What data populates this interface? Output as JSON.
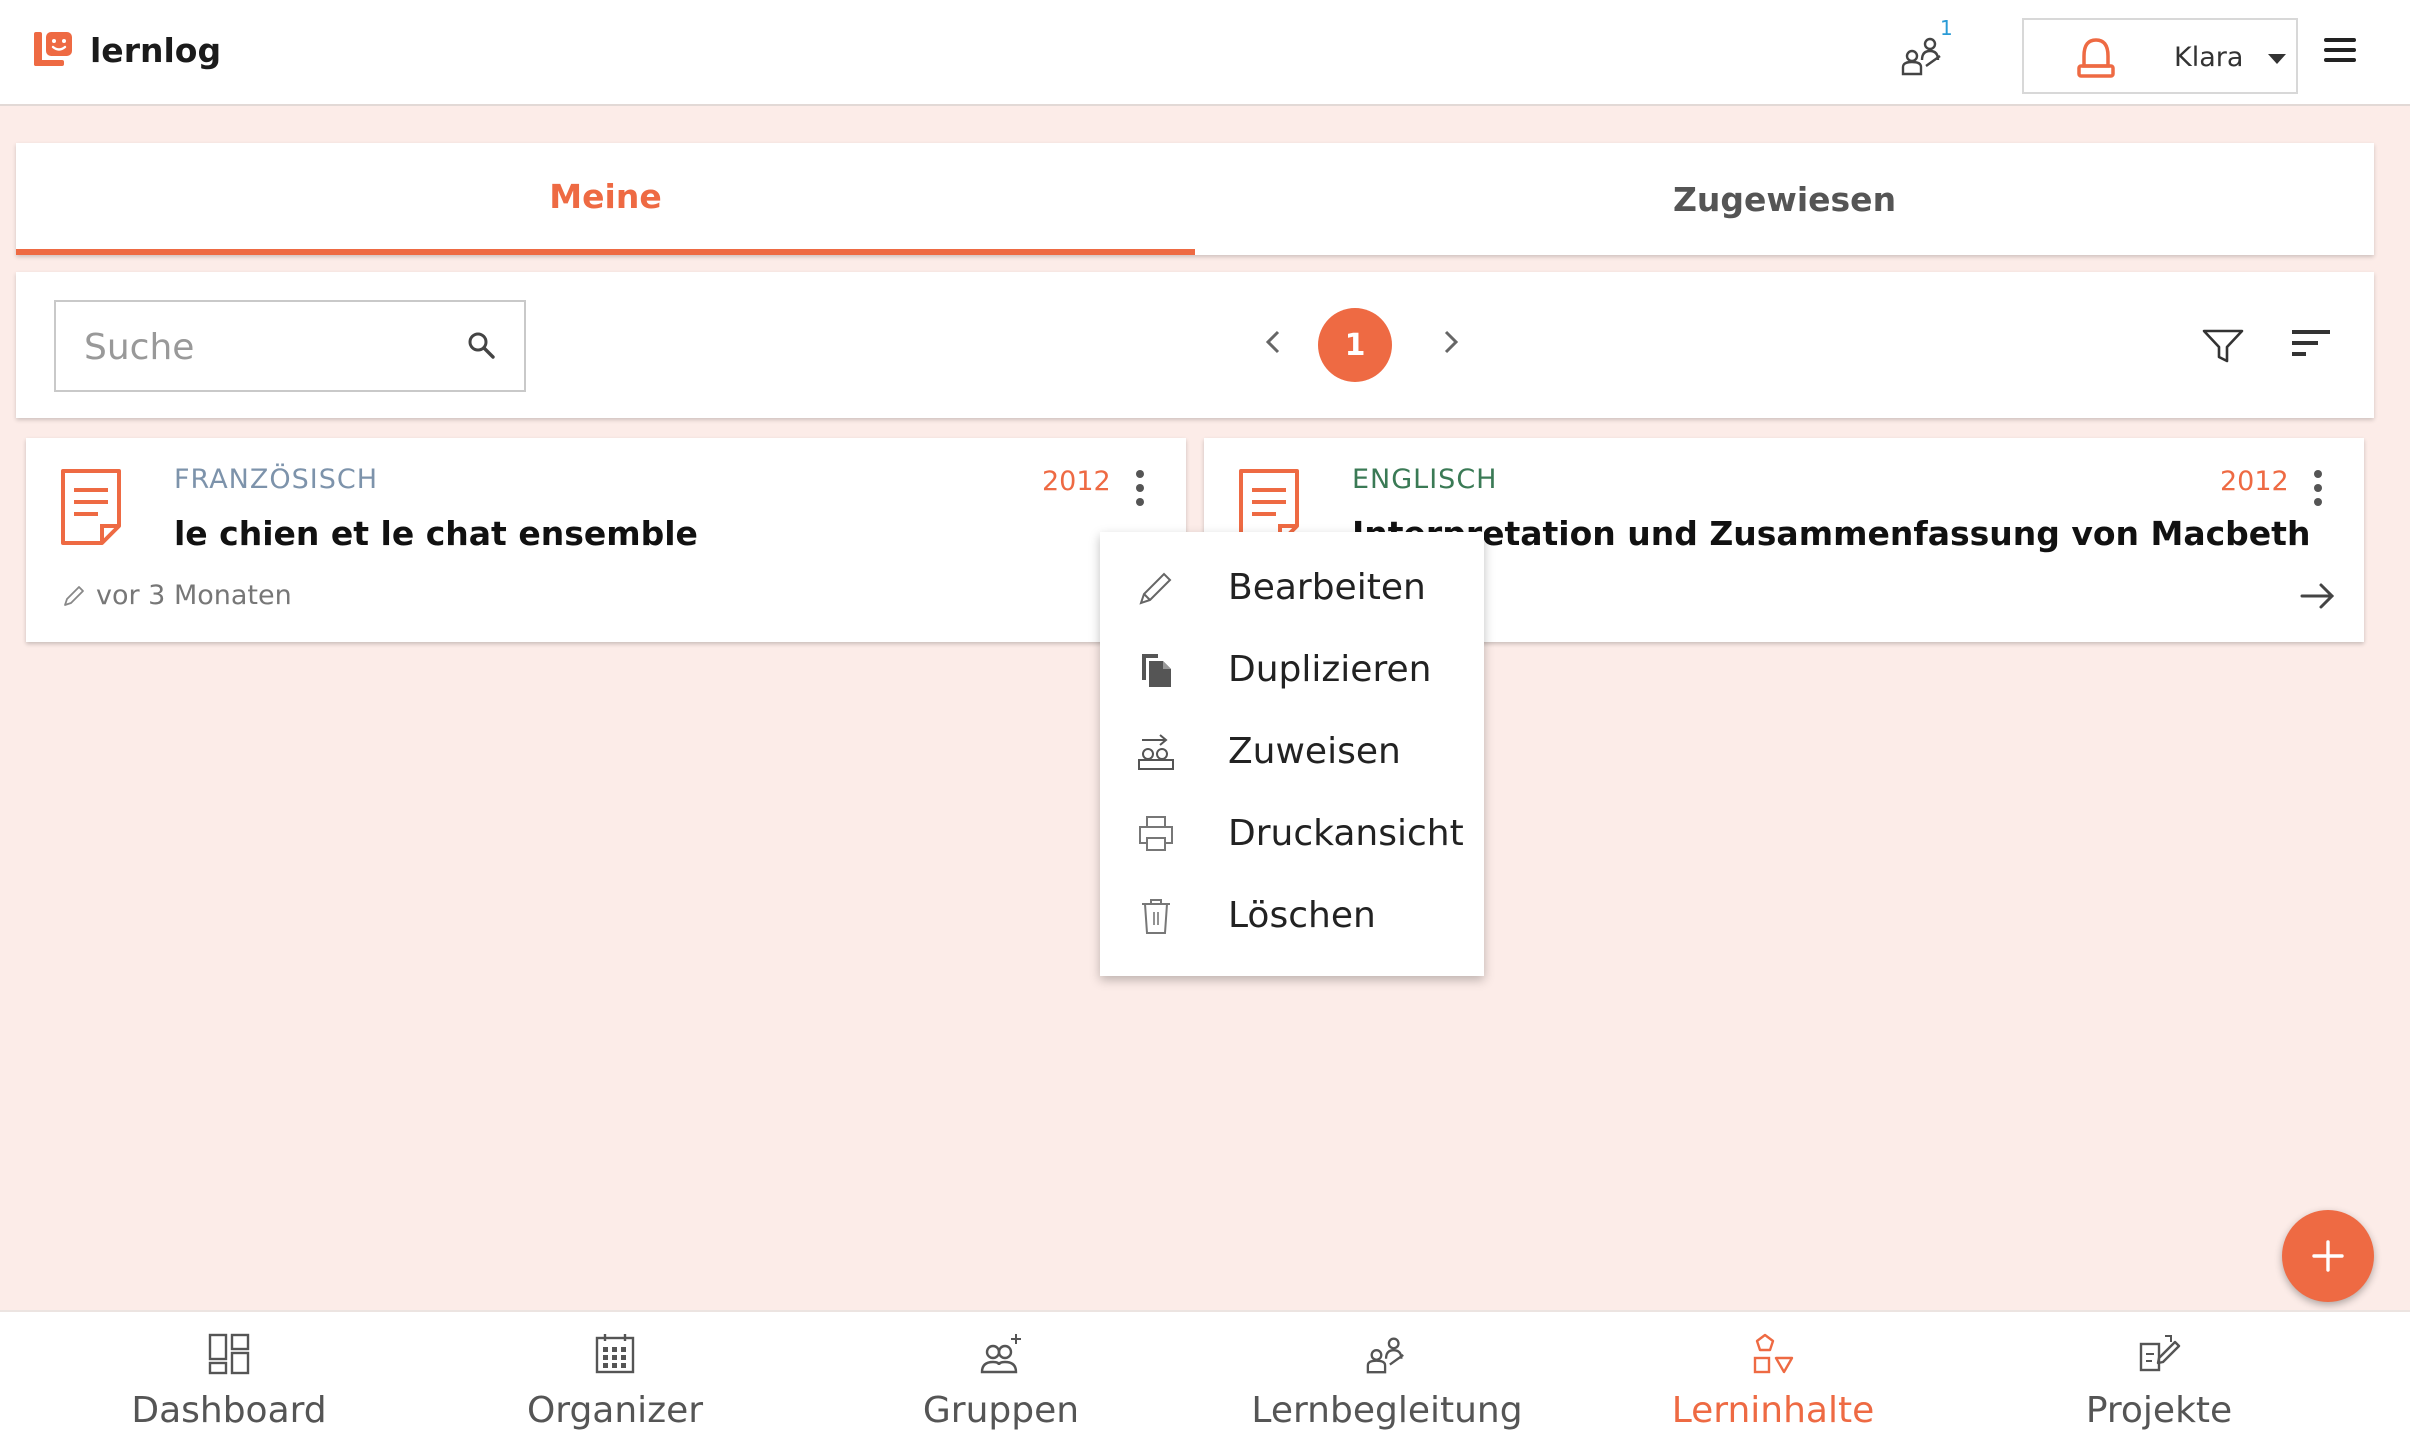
{
  "brand": {
    "name": "lernlog",
    "accent": "#ee6a43"
  },
  "header": {
    "notification_count": "1",
    "user_name": "Klara"
  },
  "tabs": [
    {
      "label": "Meine",
      "active": true
    },
    {
      "label": "Zugewiesen",
      "active": false
    }
  ],
  "toolbar": {
    "search_placeholder": "Suche",
    "current_page": "1",
    "icons": [
      "search-icon",
      "chevron-left-icon",
      "chevron-right-icon",
      "filter-icon",
      "sort-icon"
    ]
  },
  "cards": [
    {
      "subject": "FRANZÖSISCH",
      "title": "le chien et le chat ensemble",
      "year": "2012",
      "edited": "vor 3 Monaten",
      "subject_color": "#7d93ab"
    },
    {
      "subject": "ENGLISCH",
      "title": "Interpretation und Zusammenfassung von Macbeth",
      "year": "2012",
      "subject_color": "#3a7a55"
    }
  ],
  "context_menu": {
    "items": [
      {
        "label": "Bearbeiten",
        "icon": "pencil-icon"
      },
      {
        "label": "Duplizieren",
        "icon": "duplicate-icon"
      },
      {
        "label": "Zuweisen",
        "icon": "assign-icon"
      },
      {
        "label": "Druckansicht",
        "icon": "print-icon"
      },
      {
        "label": "Löschen",
        "icon": "trash-icon"
      }
    ]
  },
  "bottom_nav": [
    {
      "label": "Dashboard",
      "icon": "dashboard-icon",
      "active": false
    },
    {
      "label": "Organizer",
      "icon": "calendar-icon",
      "active": false
    },
    {
      "label": "Gruppen",
      "icon": "groups-icon",
      "active": false
    },
    {
      "label": "Lernbegleitung",
      "icon": "mentoring-icon",
      "active": false
    },
    {
      "label": "Lerninhalte",
      "icon": "shapes-icon",
      "active": true
    },
    {
      "label": "Projekte",
      "icon": "projects-icon",
      "active": false
    }
  ]
}
